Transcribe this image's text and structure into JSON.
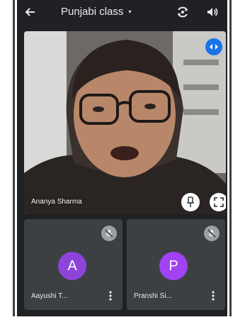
{
  "header": {
    "title": "Punjabi class",
    "caret": "▾"
  },
  "main_video": {
    "participant_name": "Ananya Sharma"
  },
  "tiles": [
    {
      "initial": "A",
      "name": "Aayushi T...",
      "avatar_color": "#8e44d8"
    },
    {
      "initial": "P",
      "name": "Pranshi Si...",
      "avatar_color": "#a142f4"
    }
  ],
  "colors": {
    "background": "#202124",
    "tile": "#3c4043",
    "accent": "#1a73e8"
  },
  "icons": [
    "back-arrow-icon",
    "switch-camera-icon",
    "speaker-icon",
    "layout-icon",
    "pin-icon",
    "fullscreen-icon",
    "mic-off-icon",
    "more-vert-icon"
  ]
}
